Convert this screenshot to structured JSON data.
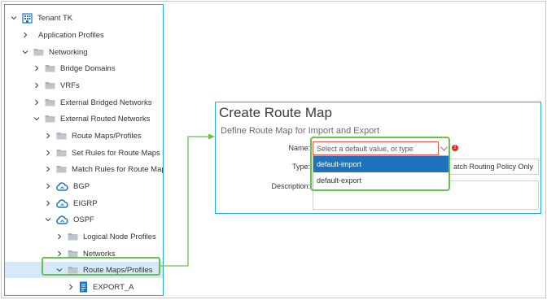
{
  "tree": {
    "items": [
      {
        "label": "Tenant TK",
        "icon": "tenant-icon",
        "chevron": "down"
      },
      {
        "label": "Application Profiles",
        "icon": "",
        "chevron": "right"
      },
      {
        "label": "Networking",
        "icon": "folder-icon",
        "chevron": "down"
      },
      {
        "label": "Bridge Domains",
        "icon": "folder-icon",
        "chevron": "right"
      },
      {
        "label": "VRFs",
        "icon": "folder-icon",
        "chevron": "right"
      },
      {
        "label": "External Bridged Networks",
        "icon": "folder-icon",
        "chevron": "right"
      },
      {
        "label": "External Routed Networks",
        "icon": "folder-icon",
        "chevron": "down"
      },
      {
        "label": "Route Maps/Profiles",
        "icon": "folder-icon",
        "chevron": "right"
      },
      {
        "label": "Set Rules for Route Maps",
        "icon": "folder-icon",
        "chevron": "right"
      },
      {
        "label": "Match Rules for Route Maps",
        "icon": "folder-icon",
        "chevron": "right"
      },
      {
        "label": "BGP",
        "icon": "cloud-icon",
        "chevron": "right"
      },
      {
        "label": "EIGRP",
        "icon": "cloud-icon",
        "chevron": "right"
      },
      {
        "label": "OSPF",
        "icon": "cloud-icon",
        "chevron": "down"
      },
      {
        "label": "Logical Node Profiles",
        "icon": "folder-icon",
        "chevron": "right"
      },
      {
        "label": "Networks",
        "icon": "folder-icon",
        "chevron": "right"
      },
      {
        "label": "Route Maps/Profiles",
        "icon": "folder-icon",
        "chevron": "down"
      },
      {
        "label": "EXPORT_A",
        "icon": "document-icon",
        "chevron": "right"
      }
    ],
    "selected_index": 15
  },
  "dialog": {
    "title": "Create Route Map",
    "subtitle": "Define Route Map for Import and Export",
    "name_label": "Name:",
    "name_placeholder": "Select a default value, or type",
    "type_label": "Type:",
    "type_value": "atch Routing Policy Only",
    "description_label": "Description:",
    "dropdown_options": [
      "default-import",
      "default-export"
    ],
    "active_option_index": 0,
    "required_marker": "!"
  },
  "colors": {
    "accent_blue": "#26a9d6",
    "highlight_green": "#6dbf4b",
    "selection_blue": "#1e73be",
    "tree_selected_bg": "#d6e9f8",
    "error_red": "#d9534f"
  }
}
